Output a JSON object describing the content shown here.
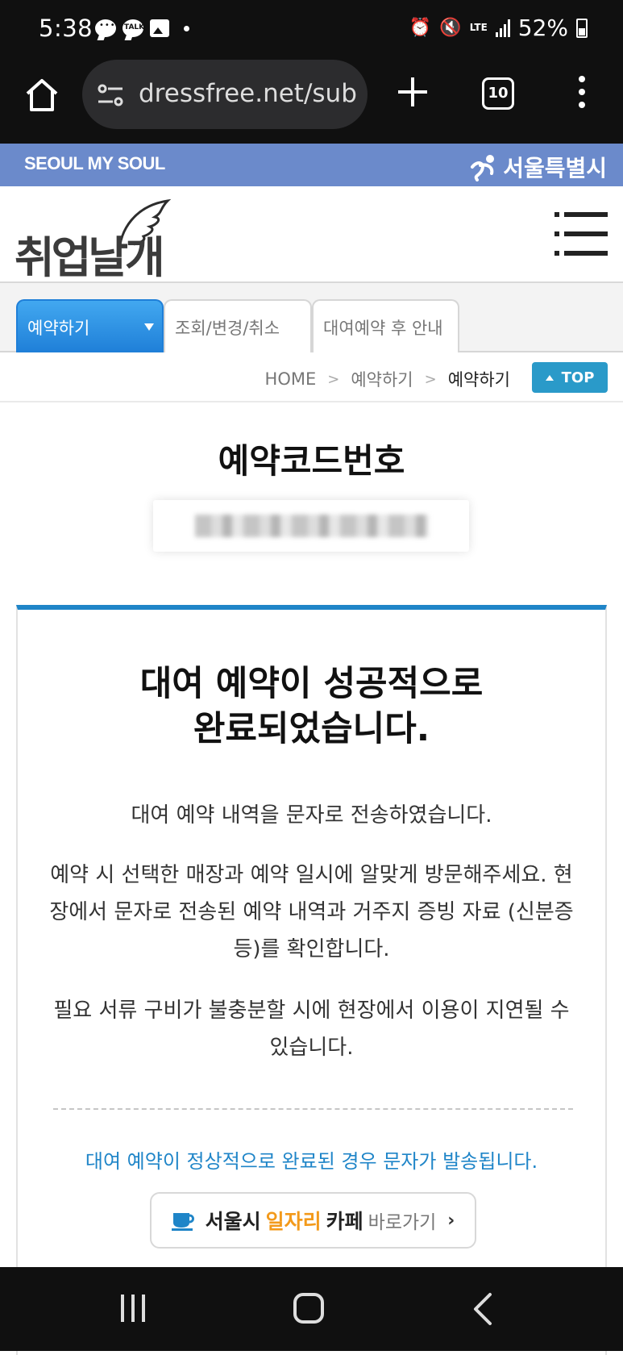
{
  "status": {
    "time": "5:38",
    "talk_label": "TALK",
    "network": "LTE",
    "battery": "52%"
  },
  "browser": {
    "url": "dressfree.net/sub",
    "tab_count": "10"
  },
  "seoul_banner": {
    "left": "SEOUL MY SOUL",
    "right": "서울특별시"
  },
  "header": {
    "logo_text": "취업날개"
  },
  "tabs": [
    {
      "label": "예약하기",
      "active": true
    },
    {
      "label": "조회/변경/취소",
      "active": false
    },
    {
      "label": "대여예약 후 안내",
      "active": false
    }
  ],
  "breadcrumb": {
    "home": "HOME",
    "level1": "예약하기",
    "current": "예약하기",
    "top_button": "TOP"
  },
  "reservation": {
    "code_title": "예약코드번호"
  },
  "card": {
    "title_line1": "대여 예약이 성공적으로",
    "title_line2": "완료되었습니다.",
    "para1": "대여 예약 내역을 문자로 전송하였습니다.",
    "para2": "예약 시 선택한 매장과 예약 일시에 알맞게 방문해주세요. 현장에서 문자로 전송된 예약 내역과 거주지 증빙 자료 (신분증 등)를 확인합니다.",
    "para3": "필요 서류 구비가 불충분할 시에 현장에서 이용이 지연될 수 있습니다.",
    "notice": "대여 예약이 정상적으로 완료된 경우 문자가 발송됩니다.",
    "cafe_button": {
      "part1": "서울시",
      "part2": "일자리",
      "part3": "카페",
      "part4": "바로가기"
    }
  },
  "colors": {
    "accent": "#1f85c8",
    "seoul_banner": "#6b8acb",
    "tab_active": "#2a8ee0",
    "cafe_orange": "#f39a1b"
  }
}
